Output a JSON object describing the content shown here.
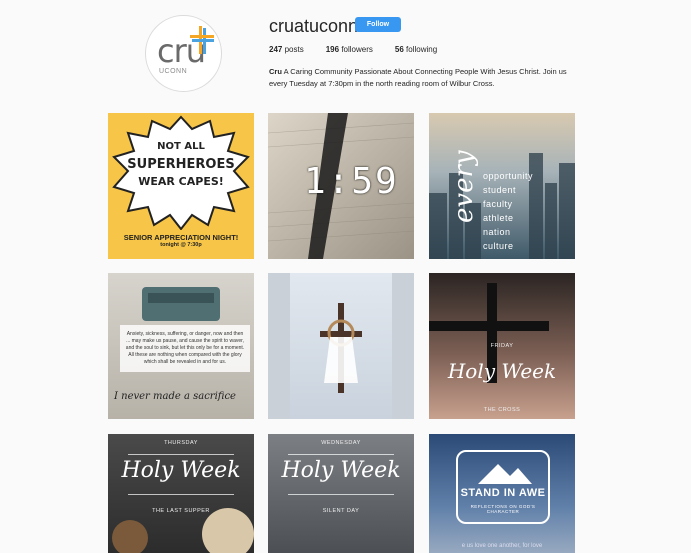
{
  "profile": {
    "username": "cruatuconn",
    "follow_label": "Follow",
    "avatar_text": "cru",
    "avatar_sub": "UCONN",
    "stats": {
      "posts_count": "247",
      "posts_label": "posts",
      "followers_count": "196",
      "followers_label": "followers",
      "following_count": "56",
      "following_label": "following"
    },
    "bio_name": "Cru",
    "bio_text": " A Caring Community Passionate About Connecting People With Jesus Christ. Join us every Tuesday at 7:30pm in the north reading room of Wilbur Cross."
  },
  "posts": {
    "p1": {
      "line1": "NOT ALL",
      "line2": "SUPERHEROES",
      "line3": "WEAR CAPES!",
      "banner": "SENIOR APPRECIATION NIGHT!",
      "sub": "tonight @ 7:30p"
    },
    "p2": {
      "clock": "1:59"
    },
    "p3": {
      "script": "every",
      "words": [
        "opportunity",
        "student",
        "faculty",
        "athlete",
        "nation",
        "culture"
      ]
    },
    "p4": {
      "quote": "Anxiety, sickness, suffering, or danger, now and then ... may make us pause, and cause the spirit to waver, and the soul to sink, but let this only be for a moment. All these are nothing when compared with the glory which shall be revealed in and for us.",
      "signature": "I never made a sacrifice"
    },
    "p6": {
      "top": "FRIDAY",
      "script": "Holy Week",
      "bottom": "THE CROSS"
    },
    "p7": {
      "top": "THURSDAY",
      "script": "Holy Week",
      "bottom": "THE LAST SUPPER"
    },
    "p8": {
      "top": "WEDNESDAY",
      "script": "Holy Week",
      "bottom": "SILENT DAY"
    },
    "p9": {
      "title": "STAND IN AWE",
      "subtitle": "REFLECTIONS ON GOD'S CHARACTER",
      "ticker": "e us love one another, for love"
    }
  },
  "colors": {
    "follow_button": "#3897f0",
    "background": "#fafafa"
  }
}
